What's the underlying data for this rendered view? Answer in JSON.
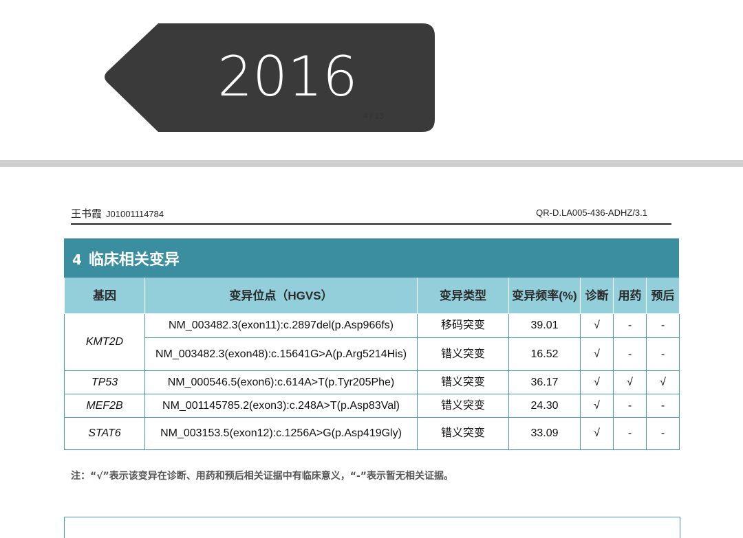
{
  "badge": {
    "year": "2016",
    "page_indicator": "4 / 13"
  },
  "header": {
    "patient_name": "王书霞",
    "patient_id": "J01001114784",
    "doc_code": "QR-D.LA005-436-ADHZ/3.1"
  },
  "section": {
    "number": "4",
    "title": "临床相关变异",
    "columns": [
      "基因",
      "变异位点（HGVS）",
      "变异类型",
      "变异频率(%)",
      "诊断",
      "用药",
      "预后"
    ],
    "rows": [
      {
        "gene": "KMT2D",
        "hgvs": "NM_003482.3(exon11):c.2897del(p.Asp966fs)",
        "type": "移码突变",
        "freq": "39.01",
        "dx": "√",
        "drug": "-",
        "prog": "-"
      },
      {
        "gene": "",
        "hgvs": "NM_003482.3(exon48):c.15641G>A(p.Arg5214His)",
        "type": "错义突变",
        "freq": "16.52",
        "dx": "√",
        "drug": "-",
        "prog": "-"
      },
      {
        "gene": "TP53",
        "hgvs": "NM_000546.5(exon6):c.614A>T(p.Tyr205Phe)",
        "type": "错义突变",
        "freq": "36.17",
        "dx": "√",
        "drug": "√",
        "prog": "√"
      },
      {
        "gene": "MEF2B",
        "hgvs": "NM_001145785.2(exon3):c.248A>T(p.Asp83Val)",
        "type": "错义突变",
        "freq": "24.30",
        "dx": "√",
        "drug": "-",
        "prog": "-"
      },
      {
        "gene": "STAT6",
        "hgvs": "NM_003153.5(exon12):c.1256A>G(p.Asp419Gly)",
        "type": "错义突变",
        "freq": "33.09",
        "dx": "√",
        "drug": "-",
        "prog": "-"
      }
    ]
  },
  "note": "注：“√”表示该变异在诊断、用药和预后相关证据中有临床意义，“-”表示暂无相关证据。",
  "colors": {
    "badge": "#3a3a3a",
    "section_header": "#3a8ea0",
    "table_header": "#93cfdb",
    "border": "#4a9aab"
  }
}
